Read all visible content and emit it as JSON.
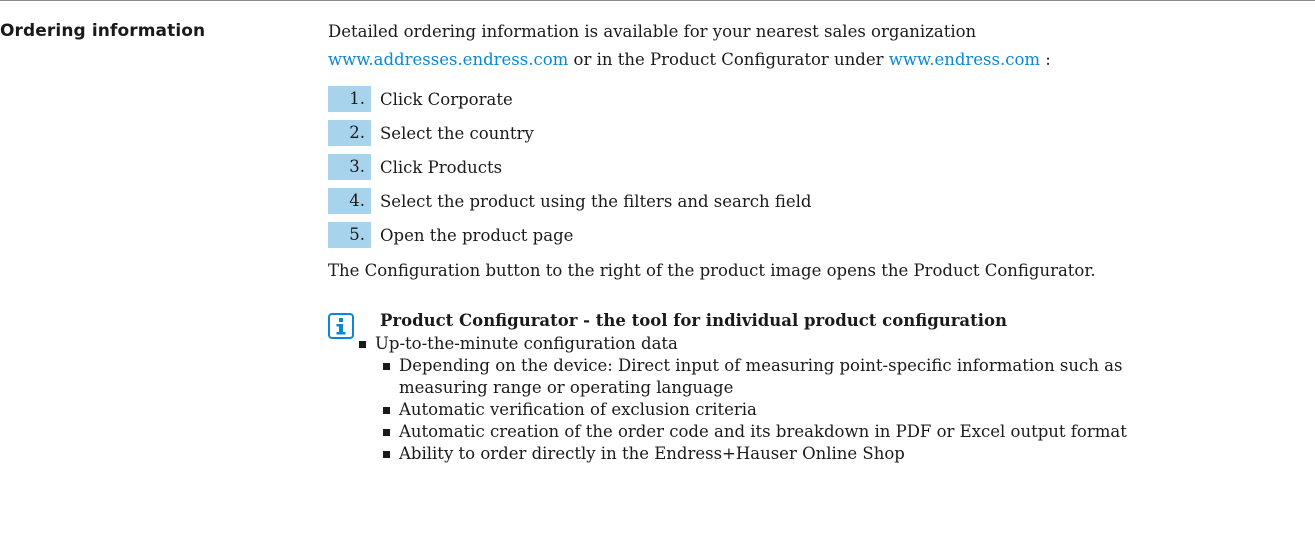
{
  "section": {
    "title": "Ordering information"
  },
  "intro": {
    "line1": "Detailed ordering information is available for your nearest sales organization",
    "link1": "www.addresses.endress.com",
    "middle": " or in the Product Configurator under ",
    "link2": "www.endress.com",
    "tail": " :"
  },
  "steps": [
    {
      "num": "1.",
      "text": "Click Corporate"
    },
    {
      "num": "2.",
      "text": "Select the country"
    },
    {
      "num": "3.",
      "text": "Click Products"
    },
    {
      "num": "4.",
      "text": "Select the product using the filters and search field"
    },
    {
      "num": "5.",
      "text": "Open the product page"
    }
  ],
  "closing": "The Configuration button to the right of the product image opens the Product Configurator.",
  "info": {
    "icon": "info-icon",
    "title": "Product Configurator - the tool for individual product configuration",
    "bullets": [
      "Up-to-the-minute configuration data",
      "Depending on the device: Direct input of measuring point-specific information such as",
      "measuring range or operating language",
      "Automatic verification of exclusion criteria",
      "Automatic creation of the order code and its breakdown in PDF or Excel output format",
      "Ability to order directly in the Endress+Hauser Online Shop"
    ]
  },
  "colors": {
    "link": "#0a88d6",
    "step_badge": "#a8d3ec",
    "icon": "#0a88d6"
  }
}
